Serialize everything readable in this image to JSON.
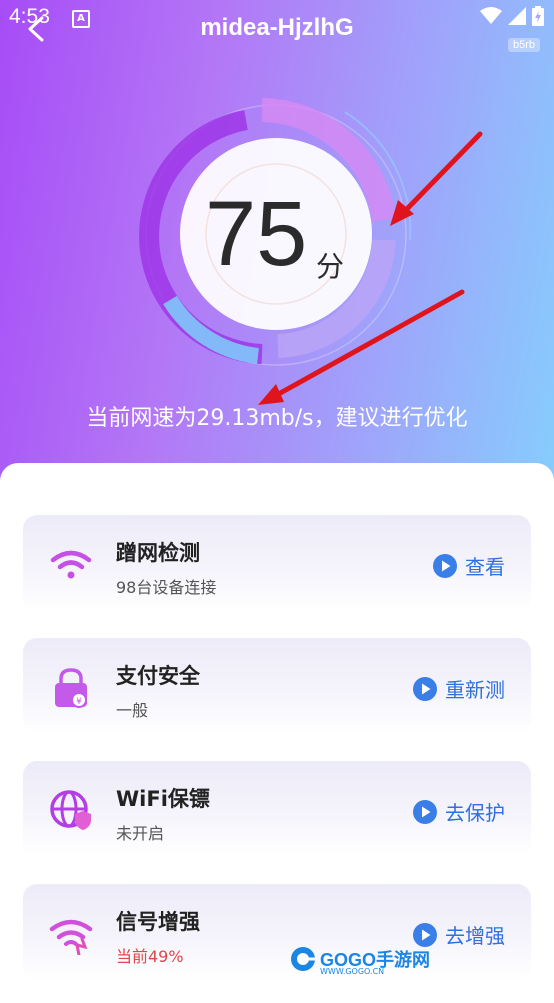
{
  "status_bar": {
    "time": "4:53",
    "notif_label": "A"
  },
  "header": {
    "title": "midea-HjzlhG",
    "badge": "b5rb"
  },
  "score": {
    "value": "75",
    "unit": "分"
  },
  "speed_text": "当前网速为29.13mb/s，建议进行优化",
  "cards": [
    {
      "title": "蹭网检测",
      "subtitle": "98台设备连接",
      "action": "查看",
      "icon": "wifi-icon",
      "subtitle_color": "#555555"
    },
    {
      "title": "支付安全",
      "subtitle": "一般",
      "action": "重新测",
      "icon": "lock-icon",
      "subtitle_color": "#555555"
    },
    {
      "title": "WiFi保镖",
      "subtitle": "未开启",
      "action": "去保护",
      "icon": "globe-shield-icon",
      "subtitle_color": "#555555"
    },
    {
      "title": "信号增强",
      "subtitle": "当前49%",
      "action": "去增强",
      "icon": "signal-boost-icon",
      "subtitle_color": "#e2454a"
    }
  ],
  "watermark": {
    "text": "GOGO手游网",
    "sub": "WWW.GOGO.CN"
  },
  "colors": {
    "accent": "#2f6fde",
    "purple": "#a74cf7",
    "warn": "#e2454a"
  }
}
